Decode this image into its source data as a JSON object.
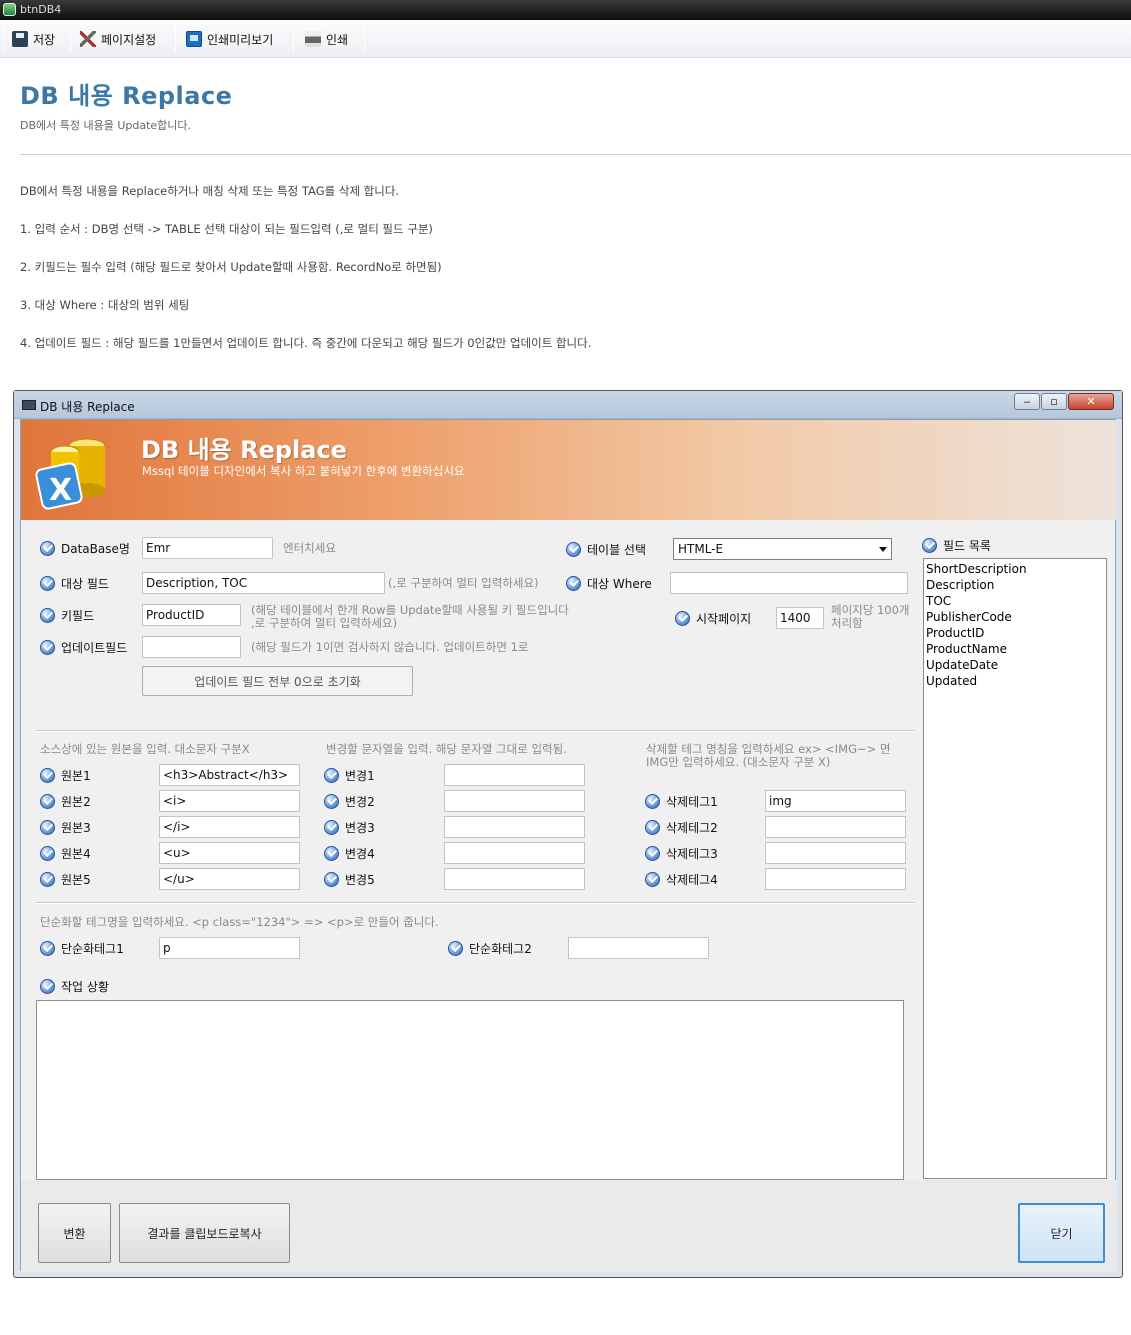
{
  "app": {
    "title": "btnDB4"
  },
  "toolbar": {
    "save": "저장",
    "page_setup": "페이지설정",
    "print_preview": "인쇄미리보기",
    "print": "인쇄"
  },
  "page": {
    "title": "DB 내용 Replace",
    "subtitle": "DB에서 특정 내용을 Update합니다."
  },
  "description": [
    "DB에서 특정 내용을 Replace하거나 매칭 삭제 또는 특정 TAG를 삭제 합니다.",
    "1. 입력 순서 : DB명 선택 -> TABLE 선택 대상이 되는 필드입력 (,로 멀티 필드 구분)",
    "2. 키필드는 필수 입력 (해당 필드로 찾아서 Update할때 사용함. RecordNo로 하면됨)",
    "3. 대상 Where : 대상의 범위 세팅",
    "4. 업데이트 필드 : 해당 필드를 1만들면서 업데이트 합니다. 즉 중간에 다운되고 해당 필드가 0인값만 업데이트 합니다."
  ],
  "window": {
    "title": "DB 내용 Replace",
    "banner_title": "DB 내용 Replace",
    "banner_sub": "Mssql 테이블 디자인에서 복사 하고 붙혀넣기 한후에 변환하십시요"
  },
  "form": {
    "database_label": "DataBase명",
    "database_value": "Emr",
    "database_hint": "엔터치세요",
    "table_label": "테이블 선택",
    "table_value": "HTML-E",
    "target_field_label": "대상 필드",
    "target_field_value": "Description, TOC",
    "target_field_hint": "(,로 구분하여 멀티 입력하세요)",
    "target_where_label": "대상 Where",
    "target_where_value": "",
    "key_field_label": "키필드",
    "key_field_value": "ProductID",
    "key_field_hint1": "(해당 테이블에서 한개 Row를 Update할때 사용될 키 필드입니다",
    "key_field_hint2": ",로 구분하여 멀티 입력하세요)",
    "start_page_label": "시작페이지",
    "start_page_value": "1400",
    "start_page_hint1": "페이지당 100개",
    "start_page_hint2": "처리함",
    "update_field_label": "업데이트필드",
    "update_field_value": "",
    "update_field_hint": "(해당 필드가 1이면 검사하지 않습니다. 업데이트하면 1로",
    "reset_button": "업데이트 필드 전부 0으로 초기화"
  },
  "field_list": {
    "label": "필드 목록",
    "items": [
      "ShortDescription",
      "Description",
      "TOC",
      "PublisherCode",
      "ProductID",
      "ProductName",
      "UpdateDate",
      "Updated"
    ]
  },
  "replace": {
    "original_hint": "소스상에 있는 원본을 입력. 대소문자 구분X",
    "change_hint": "변경할 문자열을 입력. 해당 문자열 그대로 입력됨.",
    "delete_hint1": "삭제할 테그 명칭을 입력하세요 ex> <IMG~> 면",
    "delete_hint2": "IMG만 입력하세요. (대소문자 구분 X)",
    "originals": [
      {
        "label": "원본1",
        "value": "<h3>Abstract</h3>"
      },
      {
        "label": "원본2",
        "value": "<i>"
      },
      {
        "label": "원본3",
        "value": "</i>"
      },
      {
        "label": "원본4",
        "value": "<u>"
      },
      {
        "label": "원본5",
        "value": "</u>"
      }
    ],
    "changes": [
      {
        "label": "변경1",
        "value": ""
      },
      {
        "label": "변경2",
        "value": ""
      },
      {
        "label": "변경3",
        "value": ""
      },
      {
        "label": "변경4",
        "value": ""
      },
      {
        "label": "변경5",
        "value": ""
      }
    ],
    "deletes": [
      {
        "label": "삭제테그1",
        "value": "img"
      },
      {
        "label": "삭제테그2",
        "value": ""
      },
      {
        "label": "삭제테그3",
        "value": ""
      },
      {
        "label": "삭제테그4",
        "value": ""
      }
    ]
  },
  "simplify": {
    "hint": "단순화할 테그명을 입력하세요. <p class=\"1234\"> => <p>로 만들어 줍니다.",
    "tag1_label": "단순화테그1",
    "tag1_value": "p",
    "tag2_label": "단순화테그2",
    "tag2_value": ""
  },
  "status": {
    "label": "작업 상황",
    "log": ""
  },
  "buttons": {
    "convert": "변환",
    "copy": "결과를 클립보드로복사",
    "close": "닫기"
  },
  "colors": {
    "title_blue": "#3b78a8",
    "banner_orange": "#e0753a",
    "focus_blue": "#3d8fd6"
  }
}
